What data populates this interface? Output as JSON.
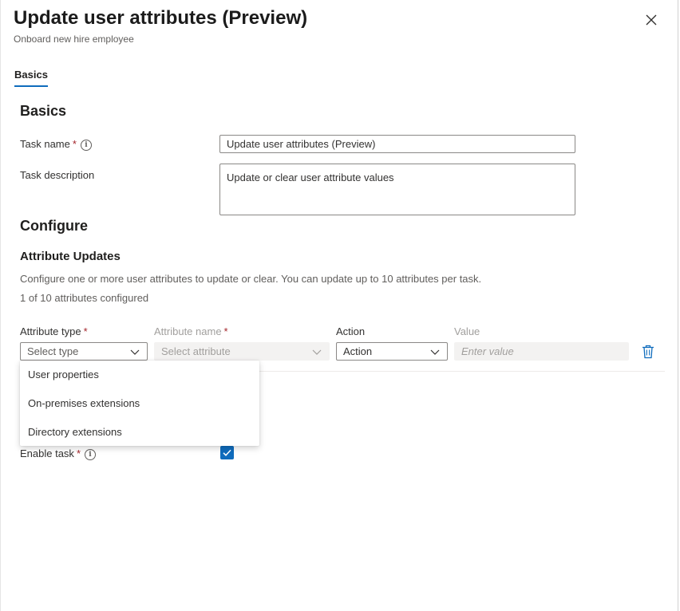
{
  "panel": {
    "title": "Update user attributes (Preview)",
    "subtitle": "Onboard new hire employee",
    "close_icon": "close-icon"
  },
  "tabs": [
    {
      "label": "Basics",
      "active": true
    }
  ],
  "basics": {
    "heading": "Basics",
    "task_name": {
      "label": "Task name",
      "required_mark": "*",
      "info_icon": "info-icon",
      "value": "Update user attributes (Preview)"
    },
    "task_description": {
      "label": "Task description",
      "value": "Update or clear user attribute values"
    }
  },
  "configure": {
    "heading": "Configure",
    "attribute_updates": {
      "heading": "Attribute Updates",
      "description": "Configure one or more user attributes to update or clear. You can update up to 10 attributes per task.",
      "count_text": "1 of 10 attributes configured",
      "columns": {
        "attribute_type": "Attribute type",
        "attribute_name": "Attribute name",
        "action": "Action",
        "value": "Value",
        "required_mark": "*"
      },
      "row": {
        "attribute_type_placeholder": "Select type",
        "attribute_name_placeholder": "Select attribute",
        "action_value": "Action",
        "value_placeholder": "Enter value",
        "delete_icon": "trash-icon"
      },
      "type_options": [
        "User properties",
        "On-premises extensions",
        "Directory extensions"
      ]
    }
  },
  "enable_task": {
    "label": "Enable task",
    "required_mark": "*",
    "info_icon": "info-icon",
    "checked": true
  },
  "colors": {
    "accent": "#0f6cbd",
    "required": "#a4262c",
    "disabled_bg": "#f3f2f1"
  }
}
